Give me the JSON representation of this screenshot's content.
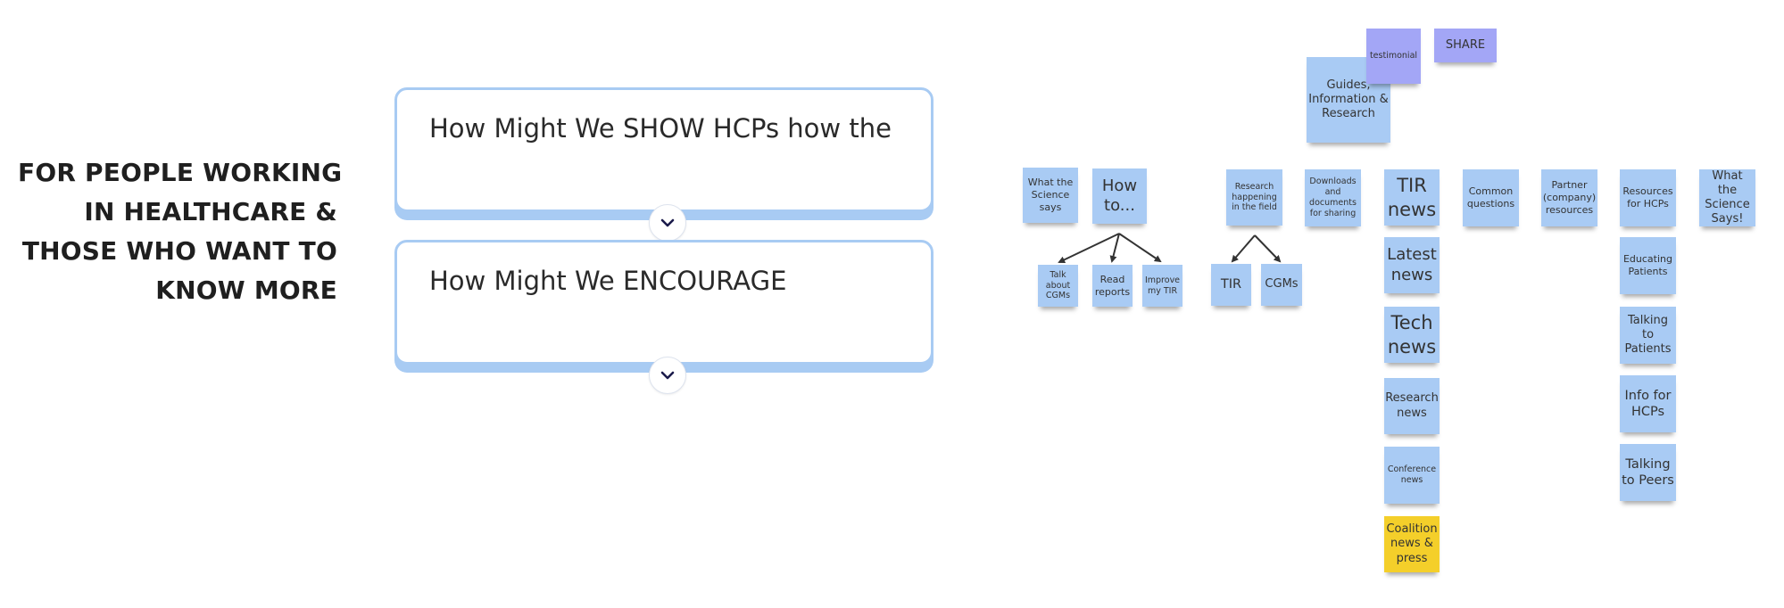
{
  "heading": {
    "lines": [
      "FOR PEOPLE WORKING",
      "IN HEALTHCARE &",
      "THOSE WHO WANT TO",
      "KNOW MORE"
    ]
  },
  "hmw_cards": [
    {
      "text": "How Might We SHOW HCPs how the",
      "expand_icon": "chevron-down-icon"
    },
    {
      "text": "How Might We ENCOURAGE",
      "expand_icon": "chevron-down-icon"
    }
  ],
  "colors": {
    "note_blue": "#a9cbf4",
    "note_purple": "#a3a6f6",
    "note_yellow": "#f4cf2a",
    "card_border": "#a8cbf3",
    "chevron": "#1b1b4b"
  },
  "notes": {
    "guides": "Guides, Information & Research",
    "testimonial": "testimonial",
    "share": "SHARE",
    "what_science_says": "What the Science says",
    "how_to": "How to...",
    "talk_cgms": "Talk about CGMs",
    "read_reports": "Read reports",
    "improve_tir": "Improve my TIR",
    "research_field": "Research happening in the field",
    "tir": "TIR",
    "cgms": "CGMs",
    "downloads": "Downloads and documents for sharing",
    "tir_news": "TIR news",
    "latest_news": "Latest news",
    "tech_news": "Tech news",
    "research_news": "Research news",
    "conference_news": "Conference news",
    "coalition_news": "Coalition news & press",
    "common_questions": "Common questions",
    "partner_resources": "Partner (company) resources",
    "resources_hcps": "Resources for HCPs",
    "educating_patients": "Educating Patients",
    "talking_patients": "Talking to Patients",
    "info_hcps": "Info for HCPs",
    "talking_peers": "Talking to Peers",
    "what_science_says_2": "What the Science Says!"
  }
}
